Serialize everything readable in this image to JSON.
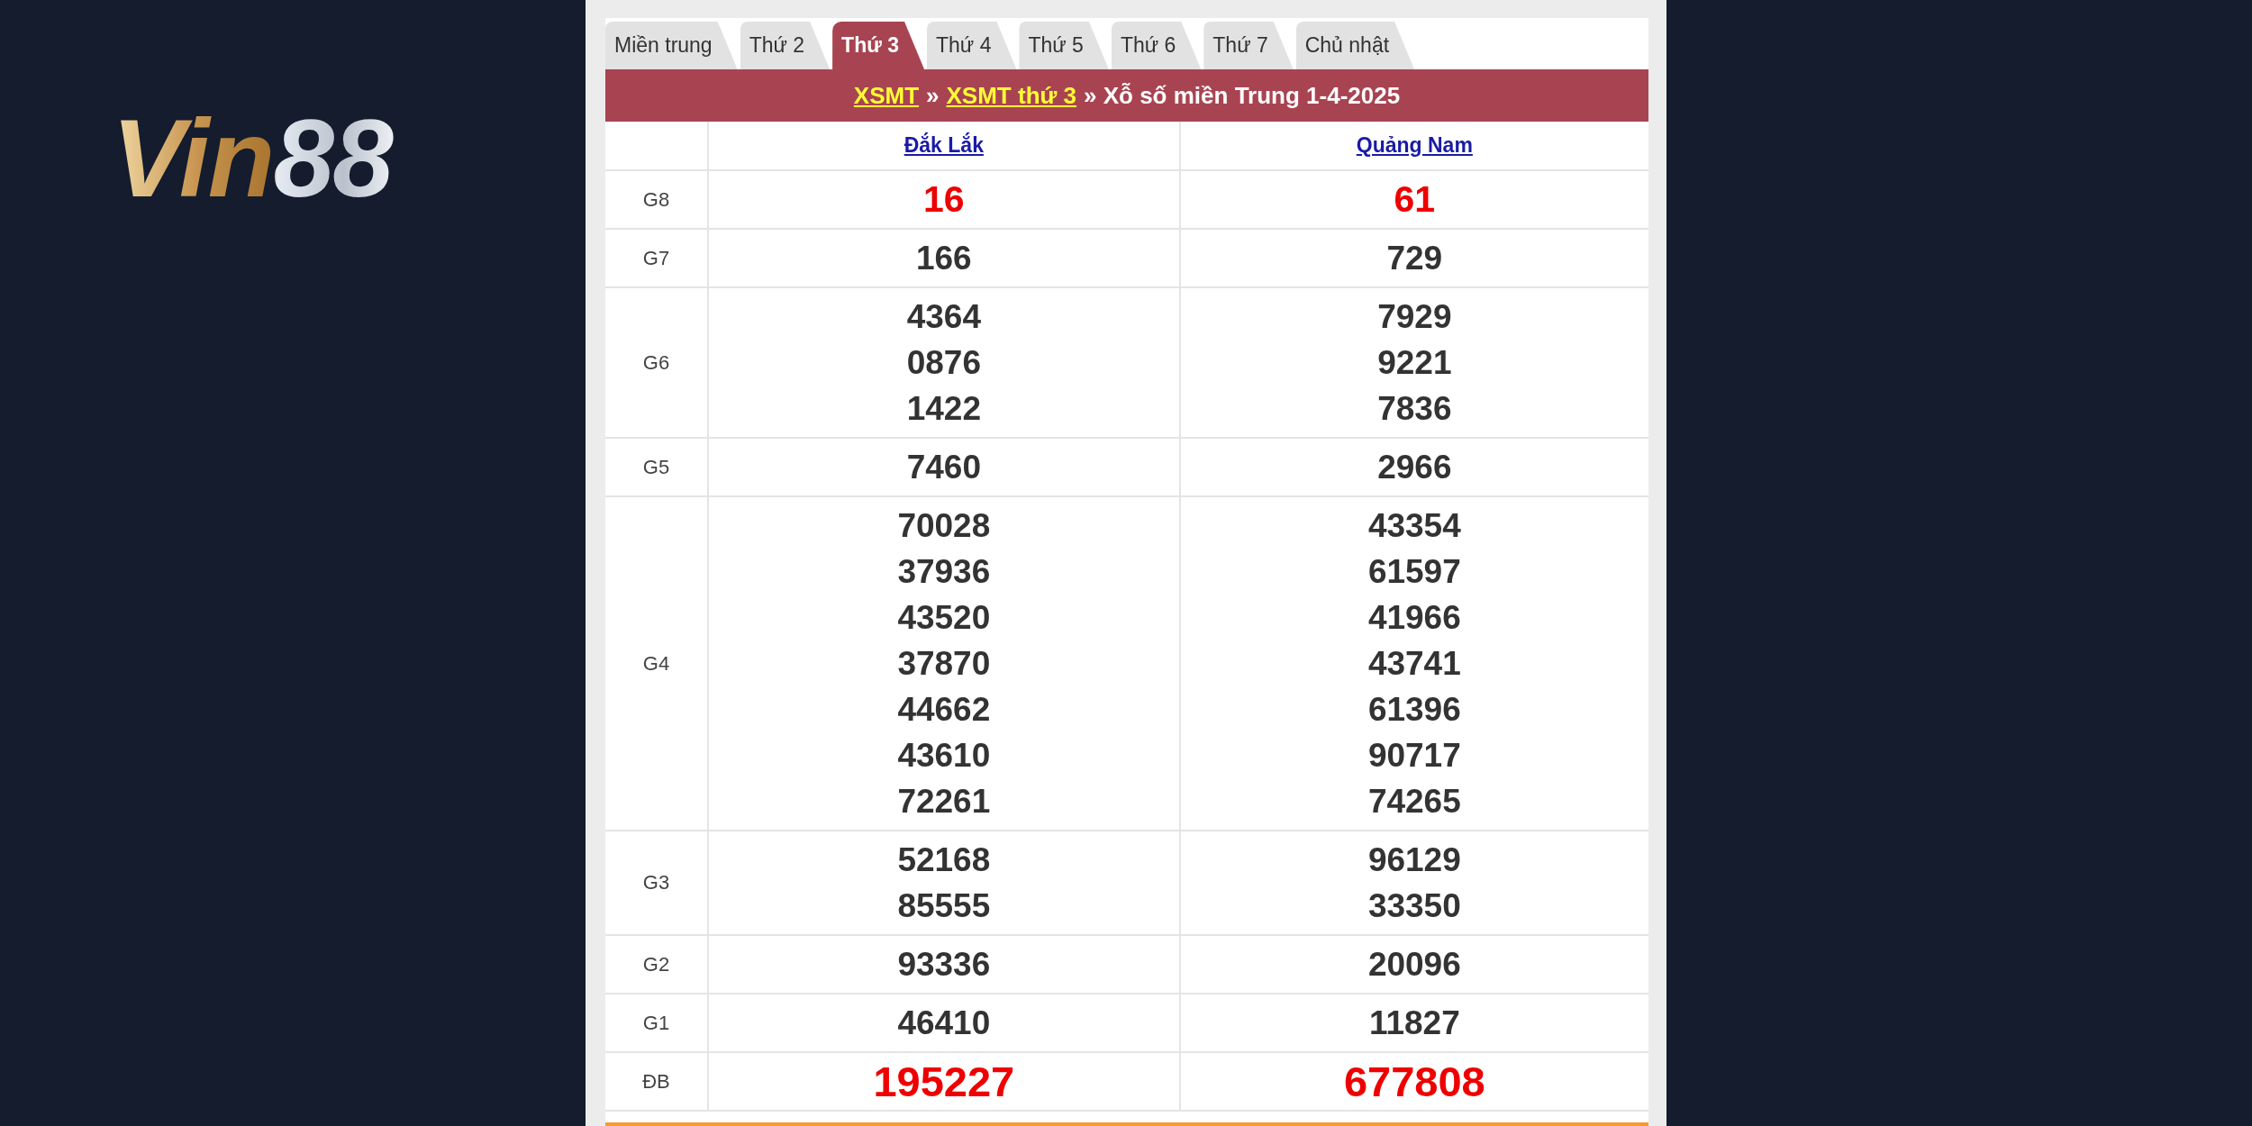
{
  "logo": "Vin88",
  "tabs": [
    {
      "label": "Miền trung",
      "selected": false
    },
    {
      "label": "Thứ 2",
      "selected": false
    },
    {
      "label": "Thứ 3",
      "selected": true
    },
    {
      "label": "Thứ 4",
      "selected": false
    },
    {
      "label": "Thứ 5",
      "selected": false
    },
    {
      "label": "Thứ 6",
      "selected": false
    },
    {
      "label": "Thứ 7",
      "selected": false
    },
    {
      "label": "Chủ nhật",
      "selected": false
    }
  ],
  "breadcrumb": [
    {
      "kind": "link",
      "text": "XSMT"
    },
    {
      "kind": "text",
      "text": "»"
    },
    {
      "kind": "link",
      "text": "XSMT thứ 3"
    },
    {
      "kind": "text",
      "text": "» Xỗ số miền Trung 1-4-2025"
    }
  ],
  "provinces": [
    "Đắk Lắk",
    "Quảng Nam"
  ],
  "rows": [
    {
      "label": "G8",
      "kind": "highlight",
      "values": [
        [
          "16"
        ],
        [
          "61"
        ]
      ]
    },
    {
      "label": "G7",
      "kind": "normal",
      "values": [
        [
          "166"
        ],
        [
          "729"
        ]
      ]
    },
    {
      "label": "G6",
      "kind": "normal",
      "values": [
        [
          "4364",
          "0876",
          "1422"
        ],
        [
          "7929",
          "9221",
          "7836"
        ]
      ]
    },
    {
      "label": "G5",
      "kind": "normal",
      "values": [
        [
          "7460"
        ],
        [
          "2966"
        ]
      ]
    },
    {
      "label": "G4",
      "kind": "normal",
      "values": [
        [
          "70028",
          "37936",
          "43520",
          "37870",
          "44662",
          "43610",
          "72261"
        ],
        [
          "43354",
          "61597",
          "41966",
          "43741",
          "61396",
          "90717",
          "74265"
        ]
      ]
    },
    {
      "label": "G3",
      "kind": "normal",
      "values": [
        [
          "52168",
          "85555"
        ],
        [
          "96129",
          "33350"
        ]
      ]
    },
    {
      "label": "G2",
      "kind": "normal",
      "values": [
        [
          "93336"
        ],
        [
          "20096"
        ]
      ]
    },
    {
      "label": "G1",
      "kind": "normal",
      "values": [
        [
          "46410"
        ],
        [
          "11827"
        ]
      ]
    },
    {
      "label": "ĐB",
      "kind": "special",
      "values": [
        [
          "195227"
        ],
        [
          "677808"
        ]
      ]
    }
  ]
}
